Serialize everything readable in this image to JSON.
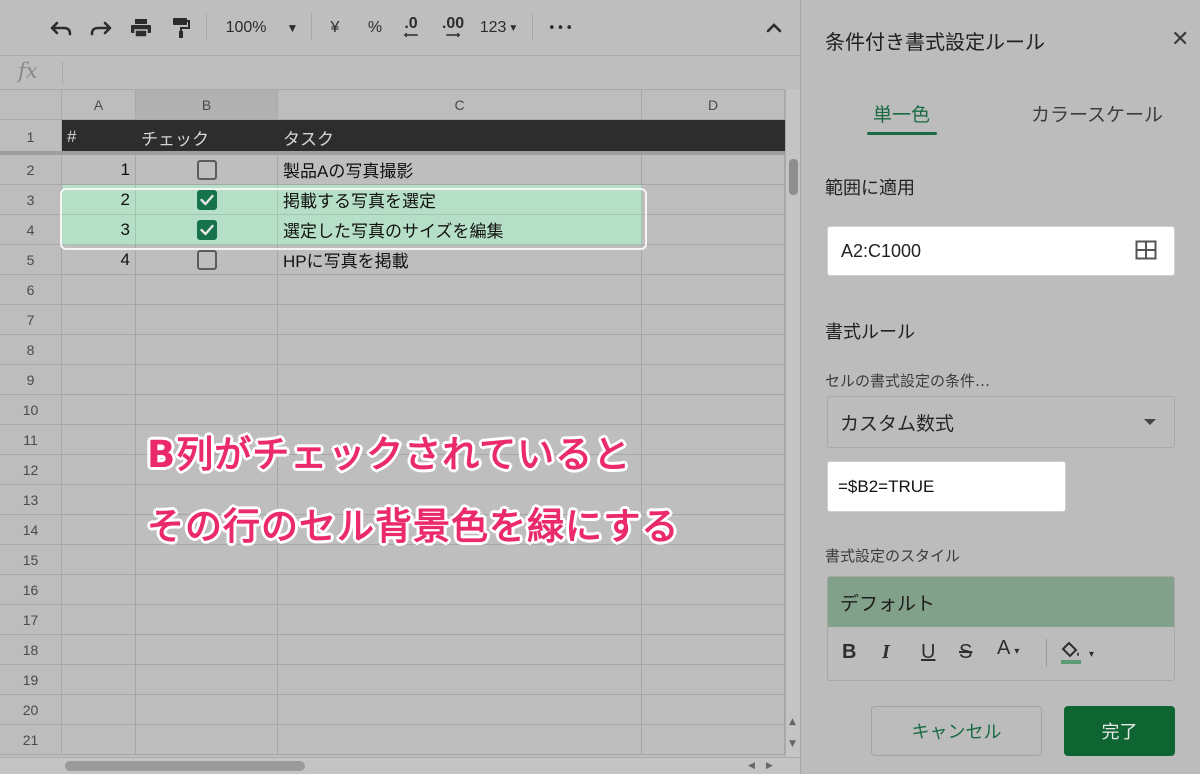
{
  "toolbar": {
    "zoom": "100%",
    "currency": "¥",
    "percent": "%",
    "decrease_decimal": ".0",
    "increase_decimal": ".00",
    "number_format": "123",
    "more": "•••"
  },
  "formula_bar": {
    "fx": "fx"
  },
  "columns": [
    "A",
    "B",
    "C",
    "D"
  ],
  "rows": [
    {
      "row": "1",
      "header": true,
      "a": "#",
      "b": "チェック",
      "c": "タスク"
    },
    {
      "row": "2",
      "a": "1",
      "checked": false,
      "c": "製品Aの写真撮影"
    },
    {
      "row": "3",
      "a": "2",
      "checked": true,
      "c": "掲載する写真を選定",
      "highlight": true
    },
    {
      "row": "4",
      "a": "3",
      "checked": true,
      "c": "選定した写真のサイズを編集",
      "highlight": true
    },
    {
      "row": "5",
      "a": "4",
      "checked": false,
      "c": "HPに写真を掲載"
    },
    {
      "row": "6"
    },
    {
      "row": "7"
    },
    {
      "row": "8"
    },
    {
      "row": "9"
    },
    {
      "row": "10"
    },
    {
      "row": "11"
    },
    {
      "row": "12"
    },
    {
      "row": "13"
    },
    {
      "row": "14"
    },
    {
      "row": "15"
    },
    {
      "row": "16"
    },
    {
      "row": "17"
    },
    {
      "row": "18"
    },
    {
      "row": "19"
    },
    {
      "row": "20"
    },
    {
      "row": "21"
    }
  ],
  "annotation": {
    "line1": "B列がチェックされていると",
    "line2": "その行のセル背景色を緑にする"
  },
  "panel": {
    "title": "条件付き書式設定ルール",
    "tab_single": "単一色",
    "tab_scale": "カラースケール",
    "range_label": "範囲に適用",
    "range_value": "A2:C1000",
    "rules_label": "書式ルール",
    "condition_label": "セルの書式設定の条件…",
    "condition_value": "カスタム数式",
    "formula_value": "=$B2=TRUE",
    "style_label": "書式設定のスタイル",
    "style_preview": "デフォルト",
    "style_tools": {
      "bold": "B",
      "italic": "I",
      "underline": "U",
      "strike": "S",
      "text_color": "A"
    },
    "cancel": "キャンセル",
    "done": "完了"
  },
  "colors": {
    "accent": "#1a6b43",
    "highlight_row": "#b6dfc7",
    "header_row": "#2d2d2d",
    "annotation_text": "#ea2a6a",
    "preview_fill": "#82a18b"
  }
}
